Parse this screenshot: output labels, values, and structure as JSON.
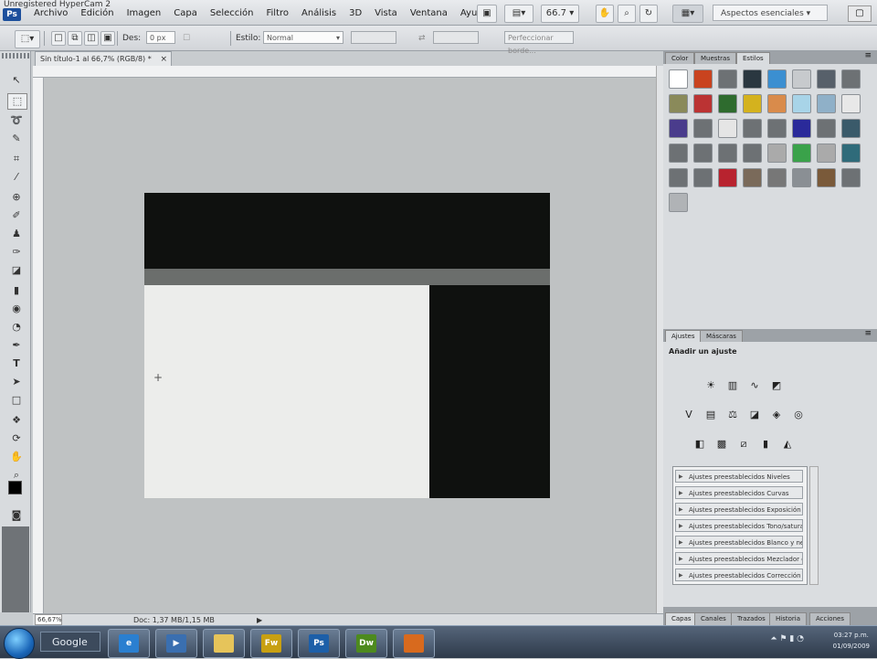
{
  "window": {
    "title": "Unregistered HyperCam 2",
    "app_logo": "Ps"
  },
  "menu": {
    "items": [
      "Archivo",
      "Edición",
      "Imagen",
      "Capa",
      "Selección",
      "Filtro",
      "Análisis",
      "3D",
      "Vista",
      "Ventana",
      "Ayuda"
    ],
    "zoom": "66.7",
    "workspace": "Aspectos esenciales"
  },
  "options": {
    "size_label": "Des:",
    "size_value": "0 px",
    "style_label": "Estilo:",
    "style_value": "Normal",
    "refine_button": "Perfeccionar borde..."
  },
  "document": {
    "tab_title": "Sin título-1 al 66,7% (RGB/8) *",
    "close": "×",
    "zoom_status": "66,67%",
    "doc_info": "Doc: 1,37 MB/1,15 MB"
  },
  "panels": {
    "top_tabs": [
      "Color",
      "Muestras",
      "Estilos"
    ],
    "top_active": "Estilos",
    "adj_tabs": [
      "Ajustes",
      "Máscaras"
    ],
    "adj_active": "Ajustes",
    "adj_title": "Añadir un ajuste",
    "presets": [
      "Ajustes preestablecidos Niveles",
      "Ajustes preestablecidos Curvas",
      "Ajustes preestablecidos Exposición",
      "Ajustes preestablecidos Tono/saturación",
      "Ajustes preestablecidos Blanco y negro",
      "Ajustes preestablecidos Mezclador de canales",
      "Ajustes preestablecidos Corrección selectiva"
    ],
    "bottom_tabs": [
      "Capas",
      "Canales",
      "Trazados",
      "Historia",
      "Acciones"
    ]
  },
  "taskbar": {
    "search_label": "Google",
    "apps": [
      {
        "name": "ie",
        "label": "e"
      },
      {
        "name": "media",
        "label": "▶"
      },
      {
        "name": "folder",
        "label": ""
      },
      {
        "name": "fireworks",
        "label": "Fw"
      },
      {
        "name": "photoshop",
        "label": "Ps"
      },
      {
        "name": "dreamweaver",
        "label": "Dw"
      },
      {
        "name": "firefox",
        "label": ""
      }
    ],
    "time": "03:27 p.m.",
    "date": "01/09/2009"
  },
  "colors": {
    "canvas_black": "#0f110f",
    "canvas_light": "#ecedeb",
    "canvas_gray": "#6b6e6c",
    "doc_background": "#bfc2c3"
  }
}
